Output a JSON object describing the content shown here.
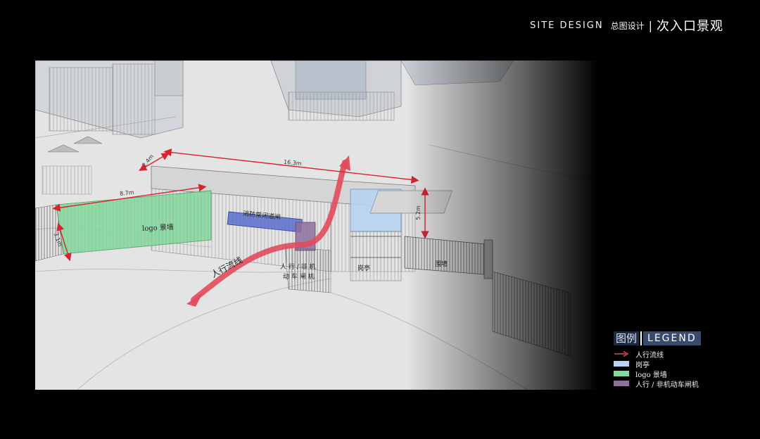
{
  "header": {
    "en": "SITE DESIGN",
    "cn_sub": "总图设计",
    "separator": "|",
    "cn_title": "次入口景观"
  },
  "labels": {
    "logo_wall": "logo 景墙",
    "fire_gate": "消防常闭道闸",
    "pedestrian_flow": "人行流线",
    "gate_machine_line1": "人 行 / 非 机",
    "gate_machine_line2": "动 车 闸 机",
    "guard_booth": "岗亭",
    "fence": "围墙"
  },
  "dimensions": {
    "d_24": "2.4m",
    "d_163": "16.3m",
    "d_87": "8.7m",
    "d_31": "3.1m",
    "d_52": "5.2m"
  },
  "legend": {
    "title_cn": "图例",
    "title_en": "LEGEND",
    "items": [
      {
        "label": "人行流线",
        "color": "#e24b5b",
        "kind": "arrow"
      },
      {
        "label": "岗亭",
        "color": "#b7d4f2",
        "kind": "swatch"
      },
      {
        "label": "logo 景墙",
        "color": "#7fd99a",
        "kind": "swatch"
      },
      {
        "label": "人行 / 非机动车闸机",
        "color": "#8e6f9e",
        "kind": "swatch"
      }
    ]
  },
  "colors": {
    "flow_arrow": "#e24b5b",
    "dimension_line": "#d8242f",
    "guard_booth": "#b7d4f2",
    "logo_wall": "#7fd99a",
    "fire_gate": "#5b6ecf",
    "gate_machine": "#8e6f9e"
  }
}
